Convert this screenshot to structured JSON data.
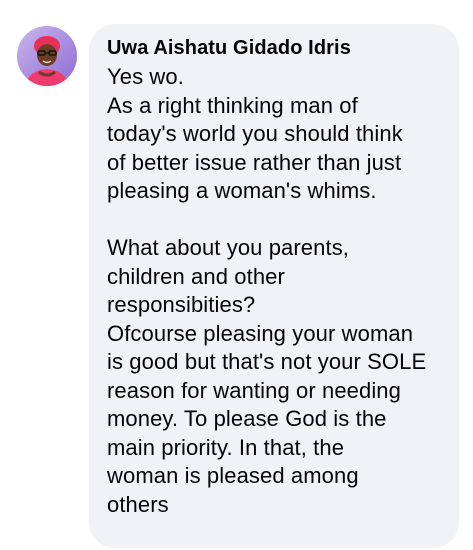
{
  "comment": {
    "author": "Uwa Aishatu Gidado Idris",
    "lines": [
      "Yes wo.",
      "As a right thinking man of",
      "today's world you should think",
      "of better issue rather than just",
      "pleasing a woman's whims.",
      "",
      "What about you parents,",
      "children and other",
      "responsibities?",
      "Ofcourse pleasing your woman",
      "is good but that's not your SOLE",
      "reason for wanting or needing",
      "money. To please God is the",
      "main priority. In that, the",
      "woman is pleased among",
      "others"
    ],
    "avatar_icon": "profile-photo"
  },
  "colors": {
    "bubble_background": "#f0f2f5",
    "text": "#050505",
    "avatar_ring": "#7b4fc9"
  }
}
